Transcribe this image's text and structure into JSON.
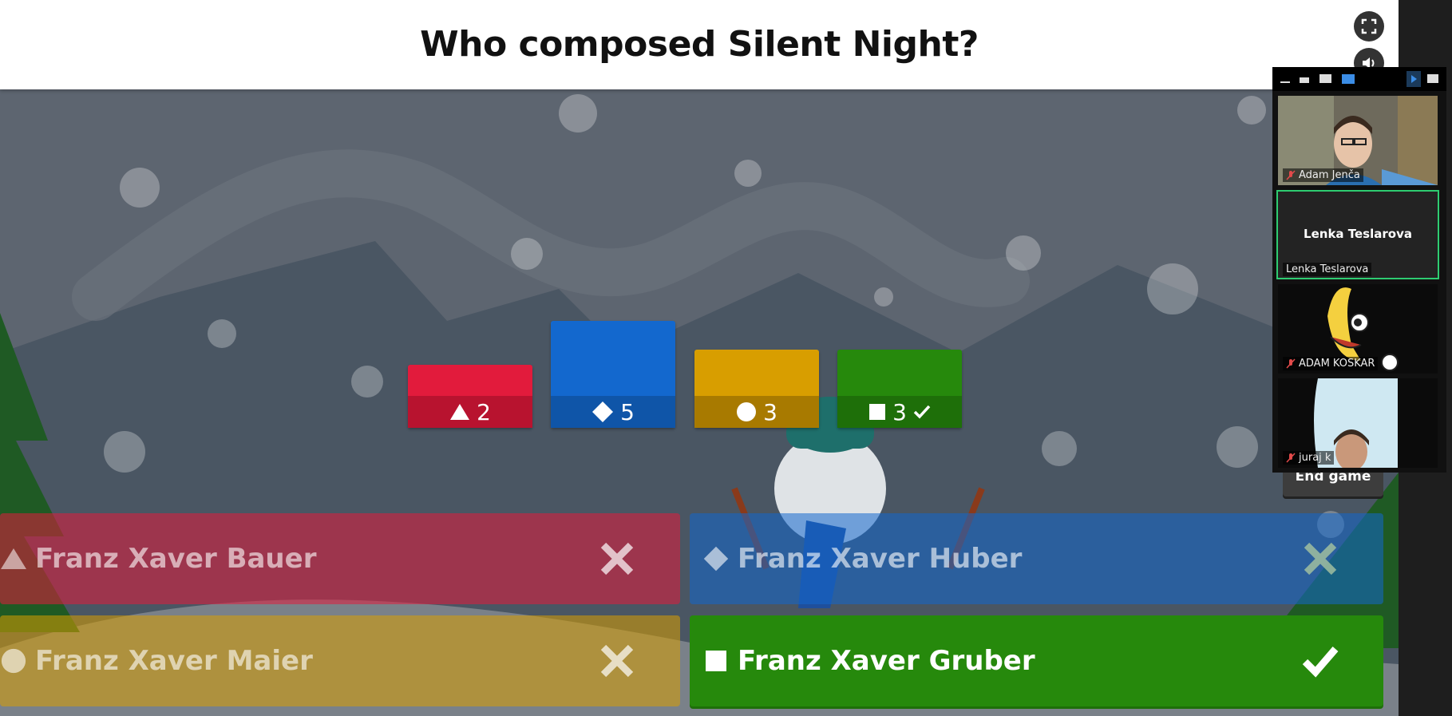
{
  "question": {
    "text": "Who composed Silent Night?"
  },
  "controls": {
    "fullscreen_icon": "fullscreen-icon",
    "volume_icon": "volume-icon"
  },
  "results": [
    {
      "shape": "triangle",
      "count": "2",
      "correct": false,
      "color": "#e21b3c",
      "dark": "#b8132f"
    },
    {
      "shape": "diamond",
      "count": "5",
      "correct": false,
      "color": "#1368ce",
      "dark": "#0f55a8"
    },
    {
      "shape": "circle",
      "count": "3",
      "correct": false,
      "color": "#d89e00",
      "dark": "#a87a00"
    },
    {
      "shape": "square",
      "count": "3",
      "correct": true,
      "color": "#26890c",
      "dark": "#1e6f09"
    }
  ],
  "answers": [
    {
      "label": "Franz Xaver Bauer",
      "shape": "triangle",
      "correct": false
    },
    {
      "label": "Franz Xaver Huber",
      "shape": "diamond",
      "correct": false
    },
    {
      "label": "Franz Xaver Maier",
      "shape": "circle",
      "correct": false
    },
    {
      "label": "Franz Xaver Gruber",
      "shape": "square",
      "correct": true
    }
  ],
  "end_game": {
    "label": "End game"
  },
  "video_call": {
    "participants": [
      {
        "name": "Adam Jenča",
        "muted": true,
        "display": "video"
      },
      {
        "name": "Lenka Teslarova",
        "center_name": "Lenka Teslarova",
        "muted": false,
        "active_speaker": true
      },
      {
        "name": "ADAM KOSKAR",
        "muted": true,
        "display": "avatar"
      },
      {
        "name": "juraj k",
        "muted": true,
        "display": "video"
      }
    ]
  }
}
